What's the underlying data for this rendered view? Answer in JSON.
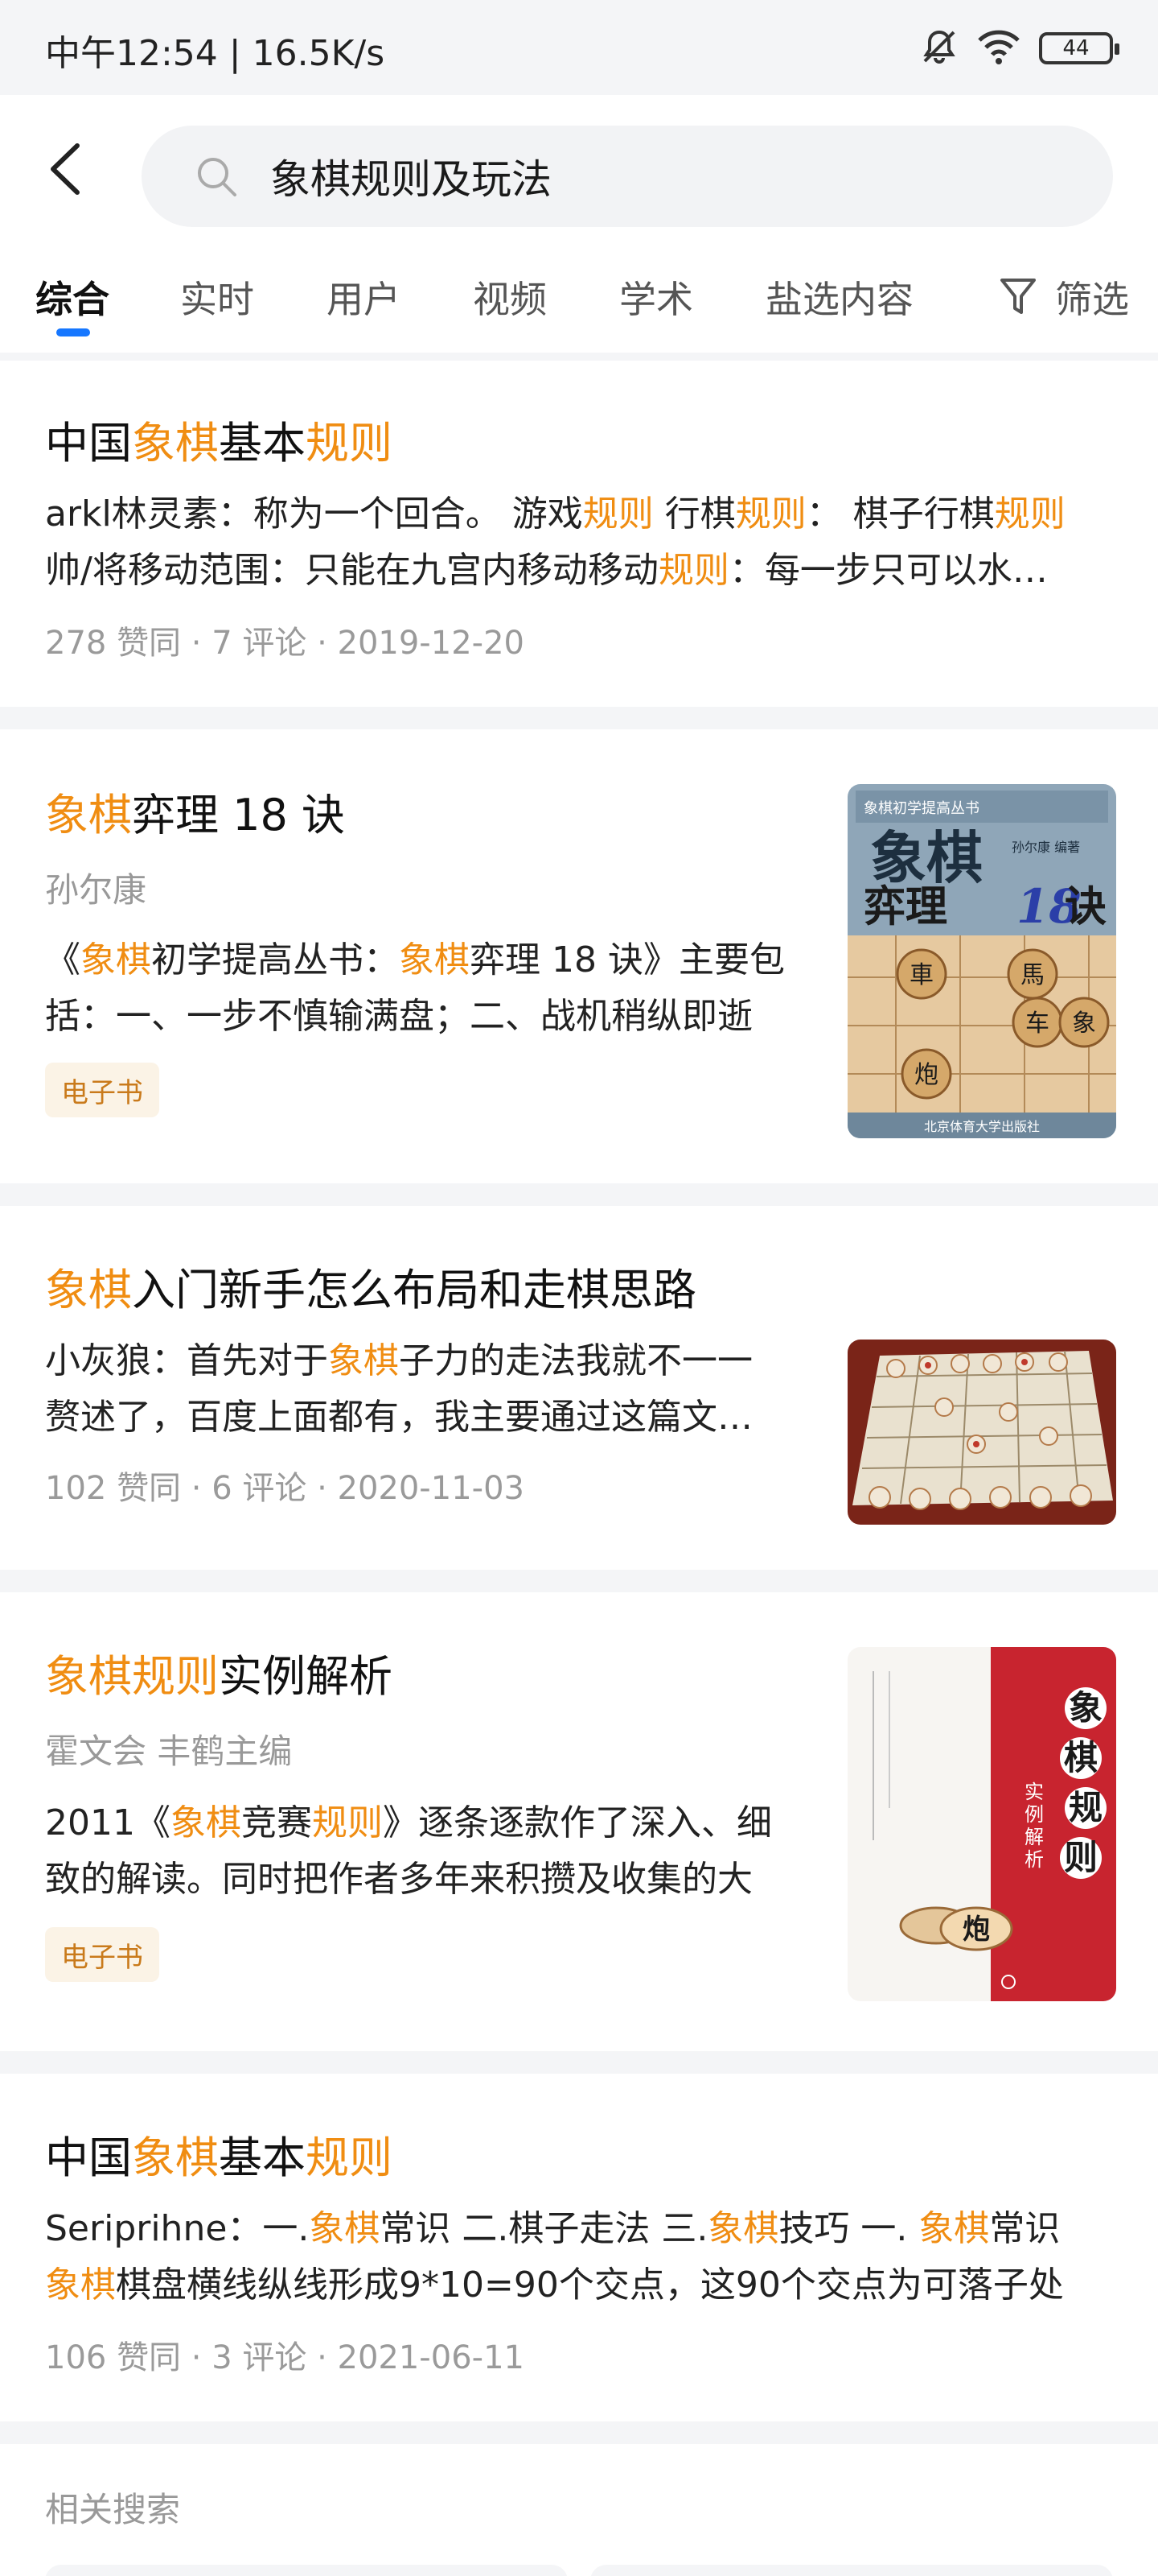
{
  "status": {
    "time_speed": "中午12:54 | 16.5K/s",
    "battery": "44"
  },
  "search": {
    "query": "象棋规则及玩法"
  },
  "tabs": [
    "综合",
    "实时",
    "用户",
    "视频",
    "学术",
    "盐选内容"
  ],
  "filter_label": "筛选",
  "cards": [
    {
      "title": [
        [
          "中国",
          false
        ],
        [
          "象棋",
          true
        ],
        [
          "基本",
          false
        ],
        [
          "规则",
          true
        ]
      ],
      "line1": [
        [
          "arkl林灵素：称为一个回合。 游戏",
          false
        ],
        [
          "规则",
          true
        ],
        [
          " 行棋",
          false
        ],
        [
          "规则",
          true
        ],
        [
          "： 棋子行棋",
          false
        ],
        [
          "规则",
          true
        ]
      ],
      "line2": [
        [
          "帅/将移动范围：只能在九宫内移动移动",
          false
        ],
        [
          "规则",
          true
        ],
        [
          "：每一步只可以水…",
          false
        ]
      ],
      "meta": "278 赞同 · 7 评论 · 2019-12-20"
    },
    {
      "title": [
        [
          "象棋",
          true
        ],
        [
          "弈理 18 诀",
          false
        ]
      ],
      "author": "孙尔康",
      "line1": [
        [
          "《",
          false
        ],
        [
          "象棋",
          true
        ],
        [
          "初学提高丛书：",
          false
        ],
        [
          "象棋",
          true
        ],
        [
          "弈理 18 诀》主要包",
          false
        ]
      ],
      "line2": [
        [
          "括：一、一步不慎输满盘；二、战机稍纵即逝",
          false
        ]
      ],
      "badge": "电子书"
    },
    {
      "title": [
        [
          "象棋",
          true
        ],
        [
          "入门新手怎么布局和走棋思路",
          false
        ]
      ],
      "line1": [
        [
          "小灰狼：首先对于",
          false
        ],
        [
          "象棋",
          true
        ],
        [
          "子力的走法我就不一一",
          false
        ]
      ],
      "line2": [
        [
          "赘述了，百度上面都有，我主要通过这篇文…",
          false
        ]
      ],
      "meta": "102 赞同 · 6 评论 · 2020-11-03"
    },
    {
      "title": [
        [
          "象棋规则",
          true
        ],
        [
          "实例解析",
          false
        ]
      ],
      "author": "霍文会 丰鹤主编",
      "line1": [
        [
          "2011《",
          false
        ],
        [
          "象棋",
          true
        ],
        [
          "竞赛",
          false
        ],
        [
          "规则",
          true
        ],
        [
          "》逐条逐款作了深入、细",
          false
        ]
      ],
      "line2": [
        [
          "致的解读。同时把作者多年来积攒及收集的大",
          false
        ]
      ],
      "badge": "电子书"
    },
    {
      "title": [
        [
          "中国",
          false
        ],
        [
          "象棋",
          true
        ],
        [
          "基本",
          false
        ],
        [
          "规则",
          true
        ]
      ],
      "line1": [
        [
          "Seriprihne：一.",
          false
        ],
        [
          "象棋",
          true
        ],
        [
          "常识 二.棋子走法 三.",
          false
        ],
        [
          "象棋",
          true
        ],
        [
          "技巧 一. ",
          false
        ],
        [
          "象棋",
          true
        ],
        [
          "常识",
          false
        ]
      ],
      "line2": [
        [
          "象棋",
          true
        ],
        [
          "棋盘横线纵线形成9*10=90个交点，这90个交点为可落子处",
          false
        ]
      ],
      "meta": "106 赞同 · 3 评论 · 2021-06-11"
    }
  ],
  "book1": {
    "series": "象棋初学提高丛书",
    "title_top": "象棋",
    "title_bottom": "弈理",
    "title_num": "18",
    "title_end": "诀",
    "author": "孙尔康 编著",
    "pieces": [
      "車",
      "馬",
      "车",
      "象",
      "炮"
    ],
    "publisher": "北京体育大学出版社"
  },
  "book2": {
    "vertical_title": [
      "象",
      "棋",
      "规",
      "则"
    ],
    "subtitle": [
      "实",
      "例",
      "解",
      "析"
    ],
    "piece": "炮"
  },
  "related": {
    "title": "相关搜索"
  },
  "colors": {
    "highlight": "#f08d12",
    "accent": "#1677ff",
    "badge_bg": "#fbf3e6"
  }
}
